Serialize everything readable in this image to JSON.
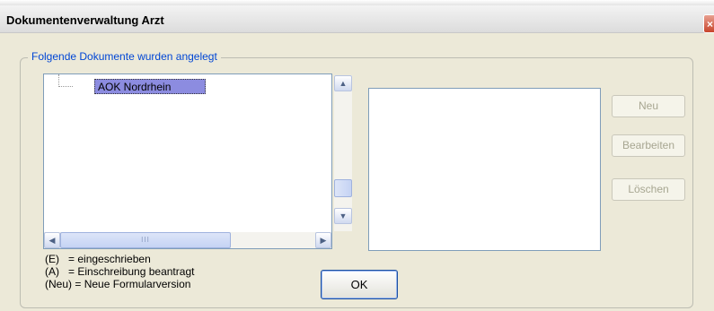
{
  "window": {
    "title": "Dokumentenverwaltung Arzt",
    "close_icon": "close-icon"
  },
  "group": {
    "label": "Folgende Dokumente wurden angelegt"
  },
  "tree": {
    "items": [
      {
        "label": "AOK Nordrhein",
        "selected": true
      }
    ]
  },
  "scrollbar": {
    "h_thumb_grip": "III"
  },
  "buttons": {
    "new": "Neu",
    "edit": "Bearbeiten",
    "delete": "Löschen",
    "ok": "OK"
  },
  "legend": [
    {
      "code": "(E)",
      "spacer": "   ",
      "text": "= eingeschrieben"
    },
    {
      "code": "(A)",
      "spacer": "   ",
      "text": "= Einschreibung beantragt"
    },
    {
      "code": "(Neu)",
      "spacer": " ",
      "text": "= Neue Formularversion"
    }
  ],
  "colors": {
    "accent": "#0046D5",
    "selection": "#8c8ce0",
    "window_bg": "#ECE9D8"
  }
}
